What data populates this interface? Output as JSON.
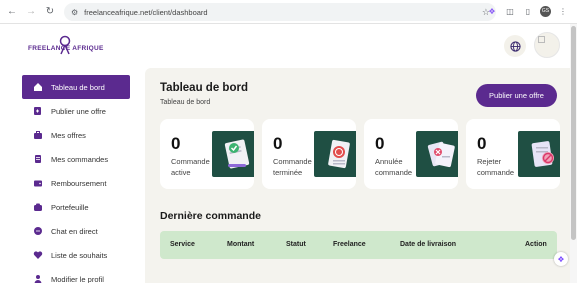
{
  "browser": {
    "url": "freelanceafrique.net/client/dashboard",
    "profile_initials": "GS"
  },
  "header": {
    "logo_text": "FREELANCE AFRIQUE"
  },
  "sidebar": {
    "items": [
      {
        "label": "Tableau de bord",
        "icon": "home-icon",
        "active": true
      },
      {
        "label": "Publier une offre",
        "icon": "file-plus-icon",
        "active": false
      },
      {
        "label": "Mes offres",
        "icon": "briefcase-icon",
        "active": false
      },
      {
        "label": "Mes commandes",
        "icon": "document-icon",
        "active": false
      },
      {
        "label": "Remboursement",
        "icon": "wallet-icon",
        "active": false
      },
      {
        "label": "Portefeuille",
        "icon": "purse-icon",
        "active": false
      },
      {
        "label": "Chat en direct",
        "icon": "chat-icon",
        "active": false
      },
      {
        "label": "Liste de souhaits",
        "icon": "heart-icon",
        "active": false
      },
      {
        "label": "Modifier le profil",
        "icon": "user-icon",
        "active": false
      }
    ]
  },
  "main": {
    "title": "Tableau de bord",
    "breadcrumb": "Tableau de bord",
    "publish_label": "Publier une offre",
    "stats": [
      {
        "value": "0",
        "label": "Commande active",
        "icon": "check-doc-icon"
      },
      {
        "value": "0",
        "label": "Commande terminée",
        "icon": "badge-doc-icon"
      },
      {
        "value": "0",
        "label": "Annulée commande",
        "icon": "cancel-doc-icon"
      },
      {
        "value": "0",
        "label": "Rejeter commande",
        "icon": "reject-doc-icon"
      }
    ],
    "section_title": "Dernière commande",
    "table_headers": [
      "Service",
      "Montant",
      "Statut",
      "Freelance",
      "Date de livraison",
      "Action"
    ]
  },
  "colors": {
    "brand": "#5b2a8f",
    "main_bg": "#f4f3ee",
    "table_header_bg": "#cfe8cc",
    "stat_icon_bg": "#1f4f43"
  }
}
